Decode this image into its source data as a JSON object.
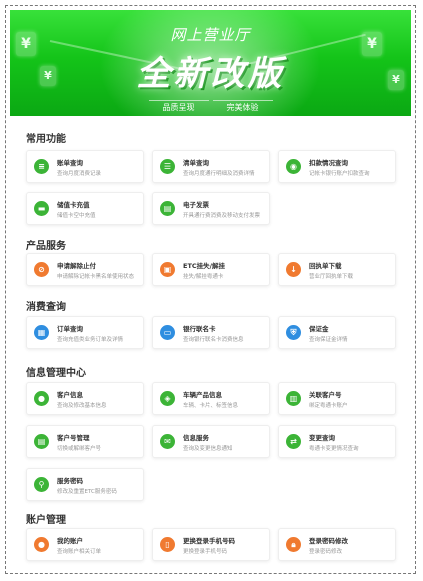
{
  "banner": {
    "subtitle": "网上营业厅",
    "title": "全新改版",
    "tags": [
      "品质呈现",
      "完美体验"
    ],
    "coin_symbol": "¥"
  },
  "sections": [
    {
      "title": "常用功能",
      "items": [
        {
          "title": "账单查询",
          "desc": "查询月度消费记录",
          "icon": "bill-icon"
        },
        {
          "title": "清单查询",
          "desc": "查询月度通行明细及消费详情",
          "icon": "list-icon"
        },
        {
          "title": "扣款情况查询",
          "desc": "记帐卡银行账户扣款查询",
          "icon": "deduction-icon"
        },
        {
          "title": "储值卡充值",
          "desc": "储值卡空中充值",
          "icon": "wallet-icon"
        },
        {
          "title": "电子发票",
          "desc": "开具通行费消费及移动支付发票",
          "icon": "invoice-icon"
        }
      ]
    },
    {
      "title": "产品服务",
      "items": [
        {
          "title": "申请解除止付",
          "desc": "申请解除记帐卡黑名单使用状态",
          "icon": "unblock-icon"
        },
        {
          "title": "ETC挂失/解挂",
          "desc": "挂失/解挂粤通卡",
          "icon": "card-lock-icon"
        },
        {
          "title": "回执单下载",
          "desc": "营业厅回执单下载",
          "icon": "download-icon"
        }
      ]
    },
    {
      "title": "消费查询",
      "items": [
        {
          "title": "订单查询",
          "desc": "查询充值类业务订单及详情",
          "icon": "order-icon"
        },
        {
          "title": "银行联名卡",
          "desc": "查询银行联名卡消费信息",
          "icon": "bank-card-icon"
        },
        {
          "title": "保证金",
          "desc": "查询保证金详情",
          "icon": "deposit-icon"
        }
      ]
    },
    {
      "title": "信息管理中心",
      "items": [
        {
          "title": "客户信息",
          "desc": "查询及修改基本信息",
          "icon": "customer-icon"
        },
        {
          "title": "车辆产品信息",
          "desc": "车辆、卡片、标签信息",
          "icon": "vehicle-icon"
        },
        {
          "title": "关联客户号",
          "desc": "绑定粤通卡账户",
          "icon": "link-account-icon"
        },
        {
          "title": "客户号管理",
          "desc": "切换或解绑客户号",
          "icon": "account-manage-icon"
        },
        {
          "title": "信息服务",
          "desc": "查询及变更信息通知",
          "icon": "message-icon"
        },
        {
          "title": "变更查询",
          "desc": "粤通卡变更情况查询",
          "icon": "change-icon"
        },
        {
          "title": "服务密码",
          "desc": "修改及重置ETC服务密码",
          "icon": "password-icon"
        }
      ]
    },
    {
      "title": "账户管理",
      "items": [
        {
          "title": "我的账户",
          "desc": "查询账户相关订单",
          "icon": "user-icon"
        },
        {
          "title": "更换登录手机号码",
          "desc": "更换登录手机号码",
          "icon": "phone-icon"
        },
        {
          "title": "登录密码修改",
          "desc": "登录密码修改",
          "icon": "lock-icon"
        }
      ]
    }
  ],
  "colors": {
    "green": "#3cb437",
    "orange": "#f07a30",
    "blue": "#2f8ee0",
    "banner_green": "#14c419"
  }
}
